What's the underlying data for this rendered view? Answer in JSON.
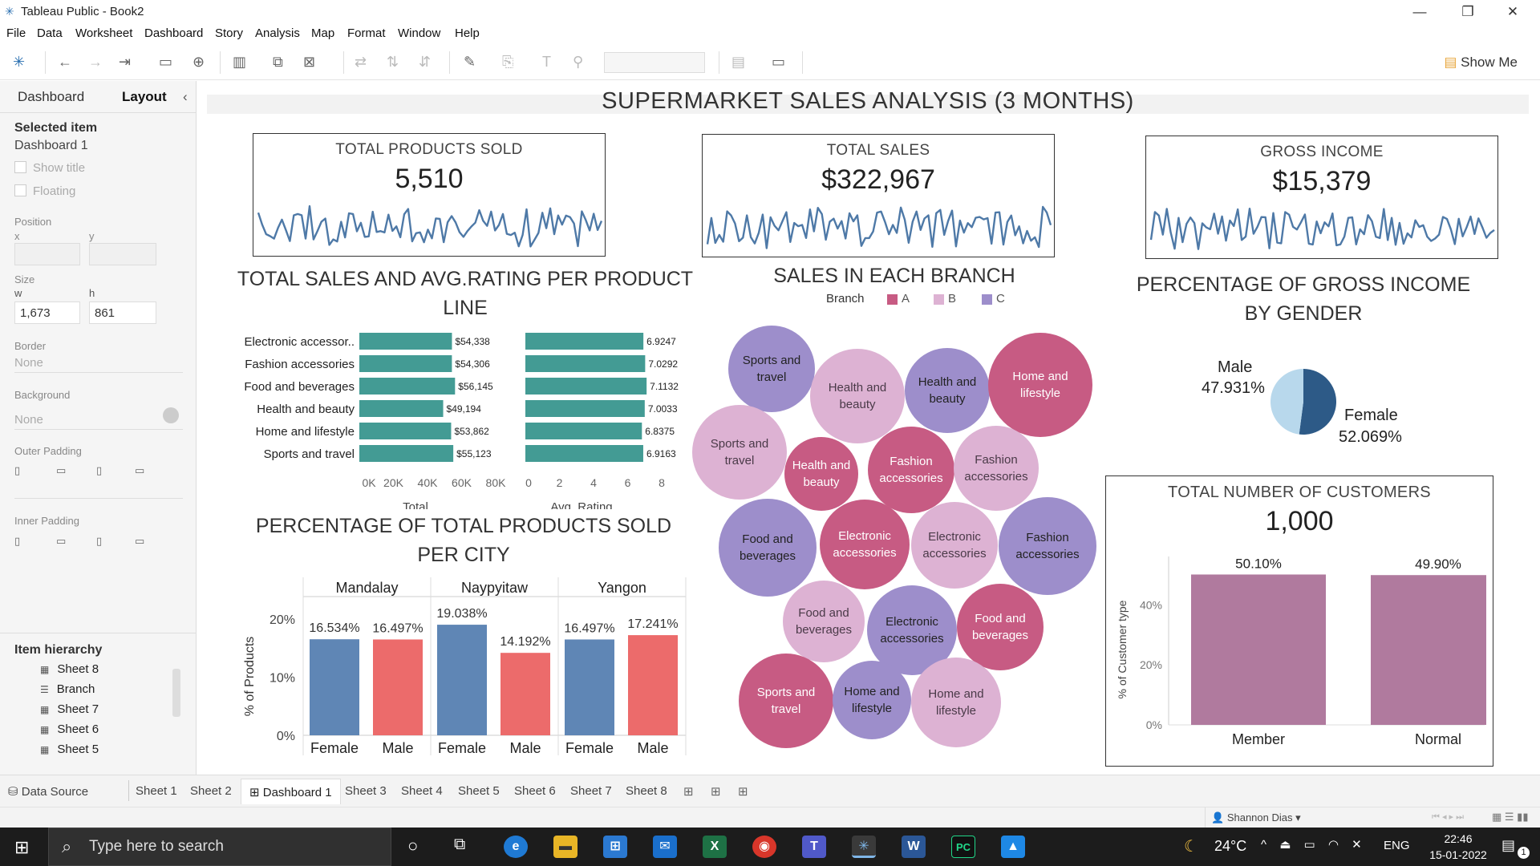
{
  "window": {
    "title": "Tableau Public - Book2",
    "controls": [
      "—",
      "❐",
      "✕"
    ]
  },
  "menu": [
    "File",
    "Data",
    "Worksheet",
    "Dashboard",
    "Story",
    "Analysis",
    "Map",
    "Format",
    "Window",
    "Help"
  ],
  "toolbar": {
    "show_me": "Show Me"
  },
  "left_panel": {
    "tabs": [
      "Dashboard",
      "Layout"
    ],
    "collapse": "‹",
    "selected_item_label": "Selected item",
    "selected_item_value": "Dashboard 1",
    "show_title": "Show title",
    "floating": "Floating",
    "position_label": "Position",
    "x_label": "x",
    "y_label": "y",
    "size_label": "Size",
    "w_label": "w",
    "h_label": "h",
    "w_value": "1,673",
    "h_value": "861",
    "border_label": "Border",
    "border_value": "None",
    "background_label": "Background",
    "background_value": "None",
    "outer_padding_label": "Outer Padding",
    "inner_padding_label": "Inner Padding",
    "item_hierarchy_label": "Item hierarchy",
    "hierarchy": [
      {
        "icon": "▦",
        "label": "Sheet 8"
      },
      {
        "icon": "☰",
        "label": "Branch"
      },
      {
        "icon": "▦",
        "label": "Sheet 7"
      },
      {
        "icon": "▦",
        "label": "Sheet 6"
      },
      {
        "icon": "▦",
        "label": "Sheet 5"
      }
    ]
  },
  "dashboard": {
    "title": "SUPERMARKET SALES ANALYSIS  (3 MONTHS)",
    "kpis": [
      {
        "label": "TOTAL PRODUCTS SOLD",
        "value": "5,510"
      },
      {
        "label": "TOTAL SALES",
        "value": "$322,967"
      },
      {
        "label": "GROSS INCOME",
        "value": "$15,379"
      }
    ],
    "product_line": {
      "title_line1": "TOTAL SALES AND AVG.RATING PER PRODUCT",
      "title_line2": "LINE",
      "categories": [
        "Electronic accessor..",
        "Fashion accessories",
        "Food and beverages",
        "Health and beauty",
        "Home and lifestyle",
        "Sports and travel"
      ],
      "totals": [
        54338,
        54306,
        56145,
        49194,
        53862,
        55123
      ],
      "total_labels": [
        "$54,338",
        "$54,306",
        "$56,145",
        "$49,194",
        "$53,862",
        "$55,123"
      ],
      "ratings": [
        6.9247,
        7.0292,
        7.1132,
        7.0033,
        6.8375,
        6.9163
      ],
      "rating_labels": [
        "6.9247",
        "7.0292",
        "7.1132",
        "7.0033",
        "6.8375",
        "6.9163"
      ],
      "total_ticks": [
        "0K",
        "20K",
        "40K",
        "60K",
        "80K"
      ],
      "rating_ticks": [
        "0",
        "2",
        "4",
        "6",
        "8"
      ],
      "total_axis_title": "Total",
      "rating_axis_title": "Avg. Rating",
      "bar_color": "#439b94"
    },
    "branch": {
      "title": "SALES IN EACH BRANCH",
      "legend_title": "Branch",
      "legend": [
        {
          "label": "A",
          "color": "#c75b83"
        },
        {
          "label": "B",
          "color": "#ddb2d3"
        },
        {
          "label": "C",
          "color": "#9d8ecb"
        }
      ],
      "bubbles": [
        {
          "label": "Sports and travel",
          "branch": "C"
        },
        {
          "label": "Health and beauty",
          "branch": "B"
        },
        {
          "label": "Health and beauty",
          "branch": "C"
        },
        {
          "label": "Home and lifestyle",
          "branch": "A"
        },
        {
          "label": "Sports and travel",
          "branch": "B"
        },
        {
          "label": "Health and beauty",
          "branch": "A"
        },
        {
          "label": "Fashion accessories",
          "branch": "A"
        },
        {
          "label": "Fashion accessories",
          "branch": "B"
        },
        {
          "label": "Food and beverages",
          "branch": "C"
        },
        {
          "label": "Electronic accessories",
          "branch": "A"
        },
        {
          "label": "Electronic accessories",
          "branch": "B"
        },
        {
          "label": "Fashion accessories",
          "branch": "C"
        },
        {
          "label": "Food and beverages",
          "branch": "B"
        },
        {
          "label": "Electronic accessories",
          "branch": "C"
        },
        {
          "label": "Food and beverages",
          "branch": "A"
        },
        {
          "label": "Sports and travel",
          "branch": "A"
        },
        {
          "label": "Home and lifestyle",
          "branch": "C"
        },
        {
          "label": "Home and lifestyle",
          "branch": "B"
        }
      ]
    },
    "gender": {
      "title_line1": "PERCENTAGE OF GROSS INCOME",
      "title_line2": "BY GENDER",
      "male_label": "Male",
      "male_value": "47.931%",
      "female_label": "Female",
      "female_value": "52.069%",
      "male_pct": 47.931,
      "female_pct": 52.069,
      "male_color": "#b8d8ec",
      "female_color": "#2d5a87"
    },
    "city": {
      "title_line1": "PERCENTAGE OF TOTAL PRODUCTS SOLD",
      "title_line2": "PER CITY",
      "cities": [
        "Mandalay",
        "Naypyitaw",
        "Yangon"
      ],
      "genders": [
        "Female",
        "Male"
      ],
      "values": [
        [
          16.534,
          16.497
        ],
        [
          19.038,
          14.192
        ],
        [
          16.497,
          17.241
        ]
      ],
      "labels": [
        [
          "16.534%",
          "16.497%"
        ],
        [
          "19.038%",
          "14.192%"
        ],
        [
          "16.497%",
          "17.241%"
        ]
      ],
      "y_ticks": [
        "20%",
        "10%",
        "0%"
      ],
      "y_axis_title": "% of Products",
      "colors": [
        "#5f86b5",
        "#ec6b6b"
      ]
    },
    "customers": {
      "title": "TOTAL NUMBER OF CUSTOMERS",
      "value": "1,000",
      "categories": [
        "Member",
        "Normal"
      ],
      "values": [
        50.1,
        49.9
      ],
      "labels": [
        "50.10%",
        "49.90%"
      ],
      "y_ticks": [
        "40%",
        "20%",
        "0%"
      ],
      "y_axis_title": "% of Customer type",
      "bar_color": "#b07a9e"
    }
  },
  "chart_data": [
    {
      "type": "bar",
      "title": "TOTAL SALES AND AVG.RATING PER PRODUCT LINE",
      "categories": [
        "Electronic accessor..",
        "Fashion accessories",
        "Food and beverages",
        "Health and beauty",
        "Home and lifestyle",
        "Sports and travel"
      ],
      "series": [
        {
          "name": "Total",
          "values": [
            54338,
            54306,
            56145,
            49194,
            53862,
            55123
          ]
        },
        {
          "name": "Avg. Rating",
          "values": [
            6.9247,
            7.0292,
            7.1132,
            7.0033,
            6.8375,
            6.9163
          ]
        }
      ],
      "xlim_total": [
        0,
        80000
      ],
      "xlim_rating": [
        0,
        8
      ]
    },
    {
      "type": "pie",
      "title": "PERCENTAGE OF GROSS INCOME BY GENDER",
      "categories": [
        "Male",
        "Female"
      ],
      "values": [
        47.931,
        52.069
      ]
    },
    {
      "type": "bar",
      "title": "PERCENTAGE OF TOTAL PRODUCTS SOLD PER CITY",
      "categories": [
        "Mandalay",
        "Naypyitaw",
        "Yangon"
      ],
      "series": [
        {
          "name": "Female",
          "values": [
            16.534,
            19.038,
            16.497
          ]
        },
        {
          "name": "Male",
          "values": [
            16.497,
            14.192,
            17.241
          ]
        }
      ],
      "ylabel": "% of Products",
      "ylim": [
        0,
        20
      ]
    },
    {
      "type": "bar",
      "title": "TOTAL NUMBER OF CUSTOMERS",
      "categories": [
        "Member",
        "Normal"
      ],
      "values": [
        50.1,
        49.9
      ],
      "ylabel": "% of Customer type",
      "ylim": [
        0,
        50
      ]
    }
  ],
  "sheet_tabs": {
    "data_source": "Data Source",
    "tabs": [
      "Sheet 1",
      "Sheet 2",
      "Dashboard 1",
      "Sheet 3",
      "Sheet 4",
      "Sheet 5",
      "Sheet 6",
      "Sheet 7",
      "Sheet 8"
    ],
    "active": "Dashboard 1"
  },
  "status": {
    "user": "Shannon Dias"
  },
  "taskbar": {
    "search_placeholder": "Type here to search",
    "temperature": "24°C",
    "language": "ENG",
    "time": "22:46",
    "date": "15-01-2022",
    "notification_count": "1"
  }
}
